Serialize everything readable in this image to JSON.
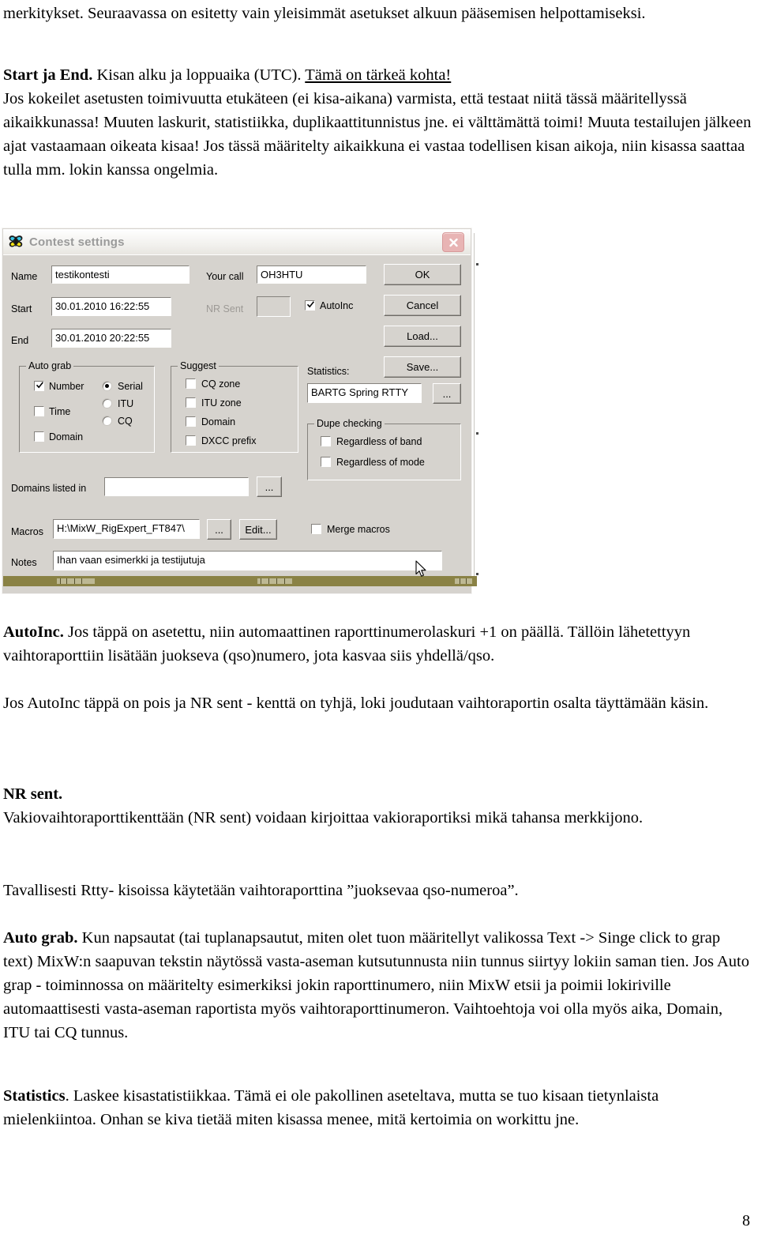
{
  "document": {
    "page_number": "8",
    "paragraphs": {
      "intro": "merkitykset. Seuraavassa on esitetty vain yleisimmät asetukset alkuun pääsemisen helpottamiseksi.",
      "start_end_heading": "Start ja End.",
      "start_end_lead": " Kisan alku ja loppuaika (UTC). ",
      "start_end_underlined": "Tämä on tärkeä kohta!",
      "start_end_body": "Jos kokeilet asetusten toimivuutta etukäteen (ei kisa-aikana) varmista, että testaat niitä tässä määritellyssä aikaikkunassa!  Muuten laskurit, statistiikka, duplikaattitunnistus  jne. ei välttämättä toimi!  Muuta testailujen jälkeen ajat vastaamaan oikeata kisaa!  Jos tässä määritelty aikaikkuna ei vastaa todellisen kisan aikoja, niin kisassa saattaa tulla mm. lokin kanssa ongelmia.",
      "autoinc_heading": "AutoInc.",
      "autoinc_body": " Jos täppä on asetettu, niin automaattinen raporttinumerolaskuri +1 on päällä. Tällöin lähetettyyn vaihtoraporttiin lisätään juokseva (qso)numero, jota kasvaa siis yhdellä/qso.",
      "autoinc_body2": "Jos AutoInc täppä on pois ja NR sent - kenttä on tyhjä, loki joudutaan vaihtoraportin osalta täyttämään käsin.",
      "nrsent_heading": "NR sent.",
      "nrsent_body": "Vakiovaihtoraporttikenttään (NR sent) voidaan kirjoittaa vakioraportiksi mikä tahansa merkkijono.",
      "tavallisesti": "Tavallisesti Rtty- kisoissa käytetään vaihtoraporttina ”juoksevaa qso-numeroa”.",
      "autograb_heading": "Auto grab.",
      "autograb_body": " Kun napsautat (tai tuplanapsautut, miten olet tuon määritellyt valikossa Text -> Singe click to grap text) MixW:n saapuvan tekstin näytössä vasta-aseman kutsutunnusta niin tunnus siirtyy lokiin  saman tien. Jos Auto grap - toiminnossa on määritelty esimerkiksi jokin raporttinumero, niin MixW etsii ja poimii lokiriville automaattisesti vasta-aseman raportista myös vaihtoraporttinumeron. Vaihtoehtoja voi olla myös aika,  Domain, ITU tai CQ tunnus.",
      "statistics_heading": "Statistics",
      "statistics_body": ". Laskee kisastatistiikkaa. Tämä ei ole pakollinen aseteltava, mutta se tuo kisaan tietynlaista mielenkiintoa. Onhan se kiva tietää miten kisassa menee, mitä kertoimia on workittu jne."
    }
  },
  "dialog": {
    "title": "Contest settings",
    "icon": "butterfly-icon",
    "close_label": "×",
    "fields": {
      "name_label": "Name",
      "name_value": "testikontesti",
      "start_label": "Start",
      "start_value": "30.01.2010 16:22:55",
      "end_label": "End",
      "end_value": "30.01.2010 20:22:55",
      "yourcall_label": "Your call",
      "yourcall_value": "OH3HTU",
      "nrsent_label": "NR Sent",
      "nrsent_value": "",
      "autoinc_label": "AutoInc",
      "autoinc_checked": true
    },
    "buttons": {
      "ok": "OK",
      "cancel": "Cancel",
      "load": "Load...",
      "save": "Save...",
      "stats_browse": "...",
      "domains_browse": "...",
      "macros_browse": "...",
      "macros_edit": "Edit..."
    },
    "auto_grab": {
      "title": "Auto grab",
      "checks": [
        {
          "label": "Number",
          "checked": true
        },
        {
          "label": "Time",
          "checked": false
        },
        {
          "label": "Domain",
          "checked": false
        }
      ],
      "radios": [
        {
          "label": "Serial",
          "selected": true
        },
        {
          "label": "ITU",
          "selected": false
        },
        {
          "label": "CQ",
          "selected": false
        }
      ]
    },
    "suggest": {
      "title": "Suggest",
      "checks": [
        {
          "label": "CQ zone",
          "checked": false
        },
        {
          "label": "ITU zone",
          "checked": false
        },
        {
          "label": "Domain",
          "checked": false
        },
        {
          "label": "DXCC prefix",
          "checked": false
        }
      ]
    },
    "statistics": {
      "label": "Statistics:",
      "value": "BARTG Spring RTTY"
    },
    "dupe_checking": {
      "title": "Dupe checking",
      "checks": [
        {
          "label": "Regardless of band",
          "checked": false
        },
        {
          "label": "Regardless of mode",
          "checked": false
        }
      ]
    },
    "domains": {
      "label": "Domains listed in",
      "value": ""
    },
    "macros": {
      "label": "Macros",
      "value": "H:\\MixW_RigExpert_FT847\\",
      "merge_label": "Merge macros",
      "merge_checked": false
    },
    "notes": {
      "label": "Notes",
      "value": "Ihan vaan esimerkki ja testijutuja"
    }
  },
  "colors": {
    "dialog_face": "#d6d3ce",
    "close_button": "#e8b4b4",
    "status_bar": "#8a8245",
    "title_text": "#9a9a9a"
  }
}
